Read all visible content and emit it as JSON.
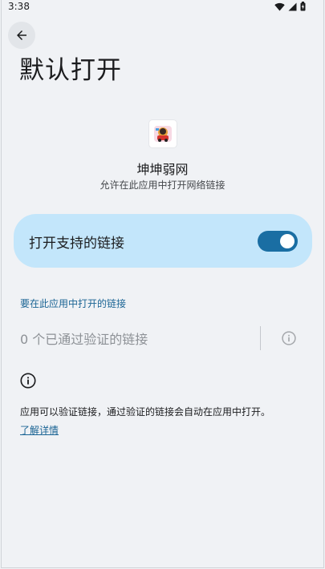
{
  "status_bar": {
    "time": "3:38",
    "icons": [
      "wifi-icon",
      "signal-icon",
      "battery-icon"
    ]
  },
  "header": {
    "back_icon": "arrow-back-icon",
    "title": "默认打开"
  },
  "app": {
    "name": "坤坤弱网",
    "description": "允许在此应用中打开网络链接"
  },
  "toggle": {
    "label": "打开支持的链接",
    "checked": true
  },
  "links": {
    "section_label": "要在此应用中打开的链接",
    "verified_count_text": "0 个已通过验证的链接",
    "info_icon": "info-icon"
  },
  "footer": {
    "info_icon": "info-icon",
    "description": "应用可以验证链接，通过验证的链接会自动在应用中打开。",
    "learn_more": "了解详情"
  },
  "colors": {
    "background": "#f0f2f5",
    "card": "#c3e6fb",
    "switch_track": "#1a6ea3",
    "accent_text": "#1a6494"
  }
}
